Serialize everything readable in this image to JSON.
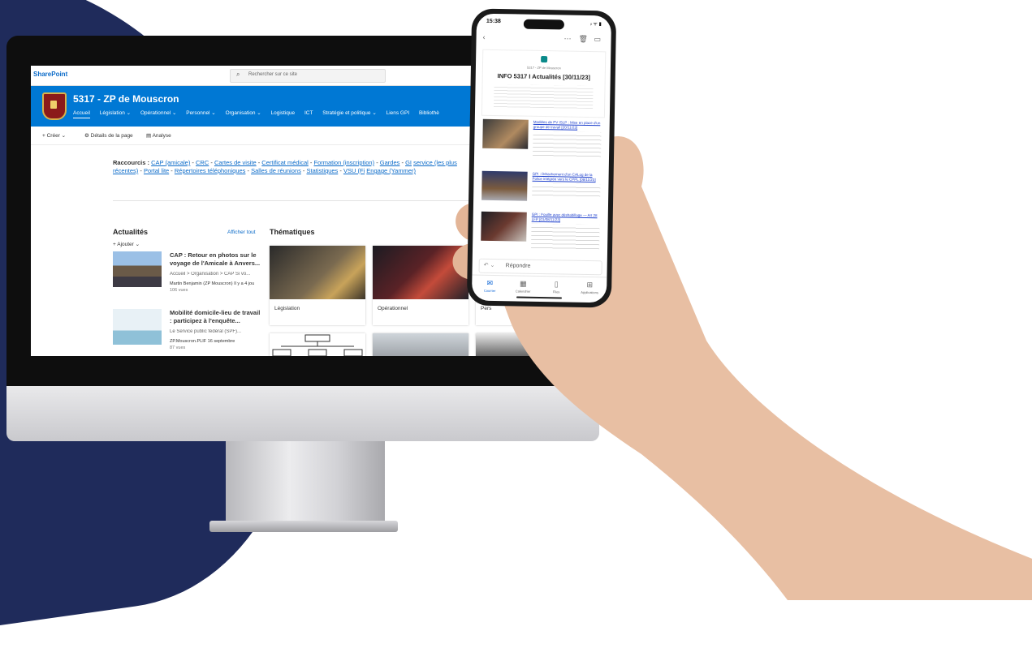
{
  "sharepoint": {
    "brand": "SharePoint",
    "search_placeholder": "Rechercher sur ce site",
    "site_title": "5317 - ZP de Mouscron",
    "nav": [
      "Accueil",
      "Législation ⌄",
      "Opérationnel ⌄",
      "Personnel ⌄",
      "Organisation ⌄",
      "Logistique",
      "ICT",
      "Stratégie et politique ⌄",
      "Liens GPI",
      "Bibliothè"
    ],
    "commands": {
      "create": "+ Créer ⌄",
      "details": "⚙ Détails de la page",
      "analysis": "▤ Analyse"
    },
    "shortcuts": {
      "label": "Raccourcis :",
      "links": [
        "CAP (amicale)",
        "CRC",
        "Cartes de visite",
        "Certificat médical",
        "Formation (inscription)",
        "Gardes",
        "GI",
        "service (les plus récentes)",
        "Portal lite",
        "Répertoires téléphoniques",
        "Salles de réunions",
        "Statistiques",
        "VSU (Fi",
        "Engage (Yammer)"
      ]
    },
    "news": {
      "title": "Actualités",
      "see_all": "Afficher tout",
      "add": "+ Ajouter ⌄",
      "items": [
        {
          "title": "CAP : Retour en photos sur le voyage de l'Amicale à Anvers...",
          "breadcrumb": "Accueil > Organisation > CAP Si vo...",
          "author": "Martin Benjamin (ZP Mouscron) Il y a 4 jou",
          "views": "106 vues"
        },
        {
          "title": "Mobilité domicile-lieu de travail : participez à l'enquête...",
          "breadcrumb": "Le Service public fédéral (SPF)...",
          "author": "ZP.Mouscron.PLIF 16 septembre",
          "views": "87 vues"
        }
      ]
    },
    "themes": {
      "title": "Thématiques",
      "tiles": [
        "Législation",
        "Opérationnel",
        "Pers"
      ]
    }
  },
  "phone": {
    "time": "15:38",
    "status": "ᵢₗ ᯤ ▮",
    "mail_sub": "5317 - ZP de Mouscron",
    "mail_title": "INFO 5317 I Actualités [30/11/23]",
    "items": [
      {
        "title": "Modèles de PV ISLP : Mise en place d'un groupe de travail [20/11/23]"
      },
      {
        "title": "GPI : Détachement d'un CALog de la Police intégrée vers le CPPL [08/11/23]"
      },
      {
        "title": "GPI : Fouille avec déshabillage — Art 28 LFP [01/08/11/23]"
      }
    ],
    "reply": "Répondre",
    "tabs": [
      "Courrier",
      "Calendrier",
      "Files",
      "Applications"
    ]
  },
  "colors": {
    "sharepoint_blue": "#0078d4",
    "background_navy": "#1f2b5b",
    "link_blue": "#0b6bc9"
  }
}
